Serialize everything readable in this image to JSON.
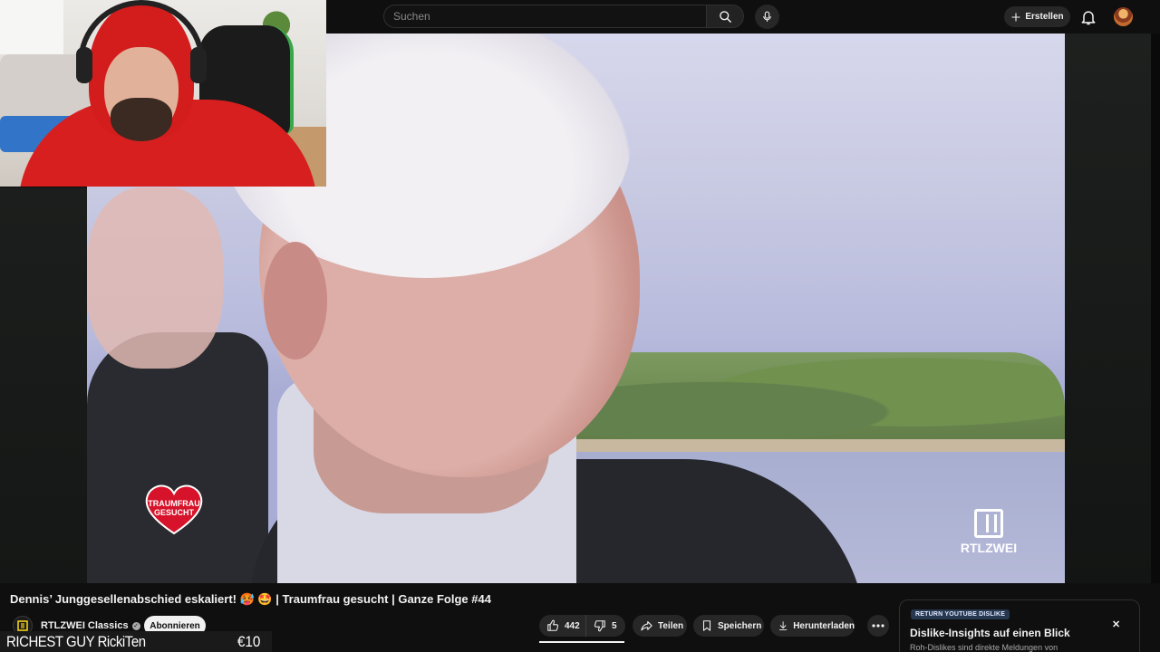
{
  "search": {
    "placeholder": "Suchen"
  },
  "header": {
    "create_label": "Erstellen"
  },
  "video": {
    "badge_text": "TRAUMFRAU GESUCHT",
    "network_logo": "RTLZWEI",
    "title": "Dennis’ Junggesellenabschied eskaliert! 🥵 🤩 | Traumfrau gesucht | Ganze Folge #44"
  },
  "channel": {
    "name": "RTLZWEI Classics",
    "avatar_text": "",
    "subscribe_label": "Abonnieren"
  },
  "overlay": {
    "name": "RICHEST GUY RickiTen",
    "amount": "€10"
  },
  "actions": {
    "likes": "442",
    "dislikes": "5",
    "like_ratio": 0.99,
    "share_label": "Teilen",
    "save_label": "Speichern",
    "download_label": "Herunterladen"
  },
  "ryd": {
    "tag": "RETURN YOUTUBE DISLIKE",
    "title": "Dislike-Insights auf einen Blick",
    "subtitle": "Roh-Dislikes sind direkte Meldungen von"
  },
  "icons": {
    "search": "search-icon",
    "mic": "mic-icon",
    "create": "plus-icon",
    "bell": "bell-icon",
    "like": "thumbs-up-icon",
    "dislike": "thumbs-down-icon",
    "share": "share-icon",
    "save": "bookmark-icon",
    "download": "download-icon",
    "more": "more-icon",
    "close": "close-icon"
  },
  "colors": {
    "background": "#0f0f0f",
    "pill": "#272727",
    "subscribe_bg": "#f1f1f1",
    "ryd_tag_bg": "#263850"
  }
}
